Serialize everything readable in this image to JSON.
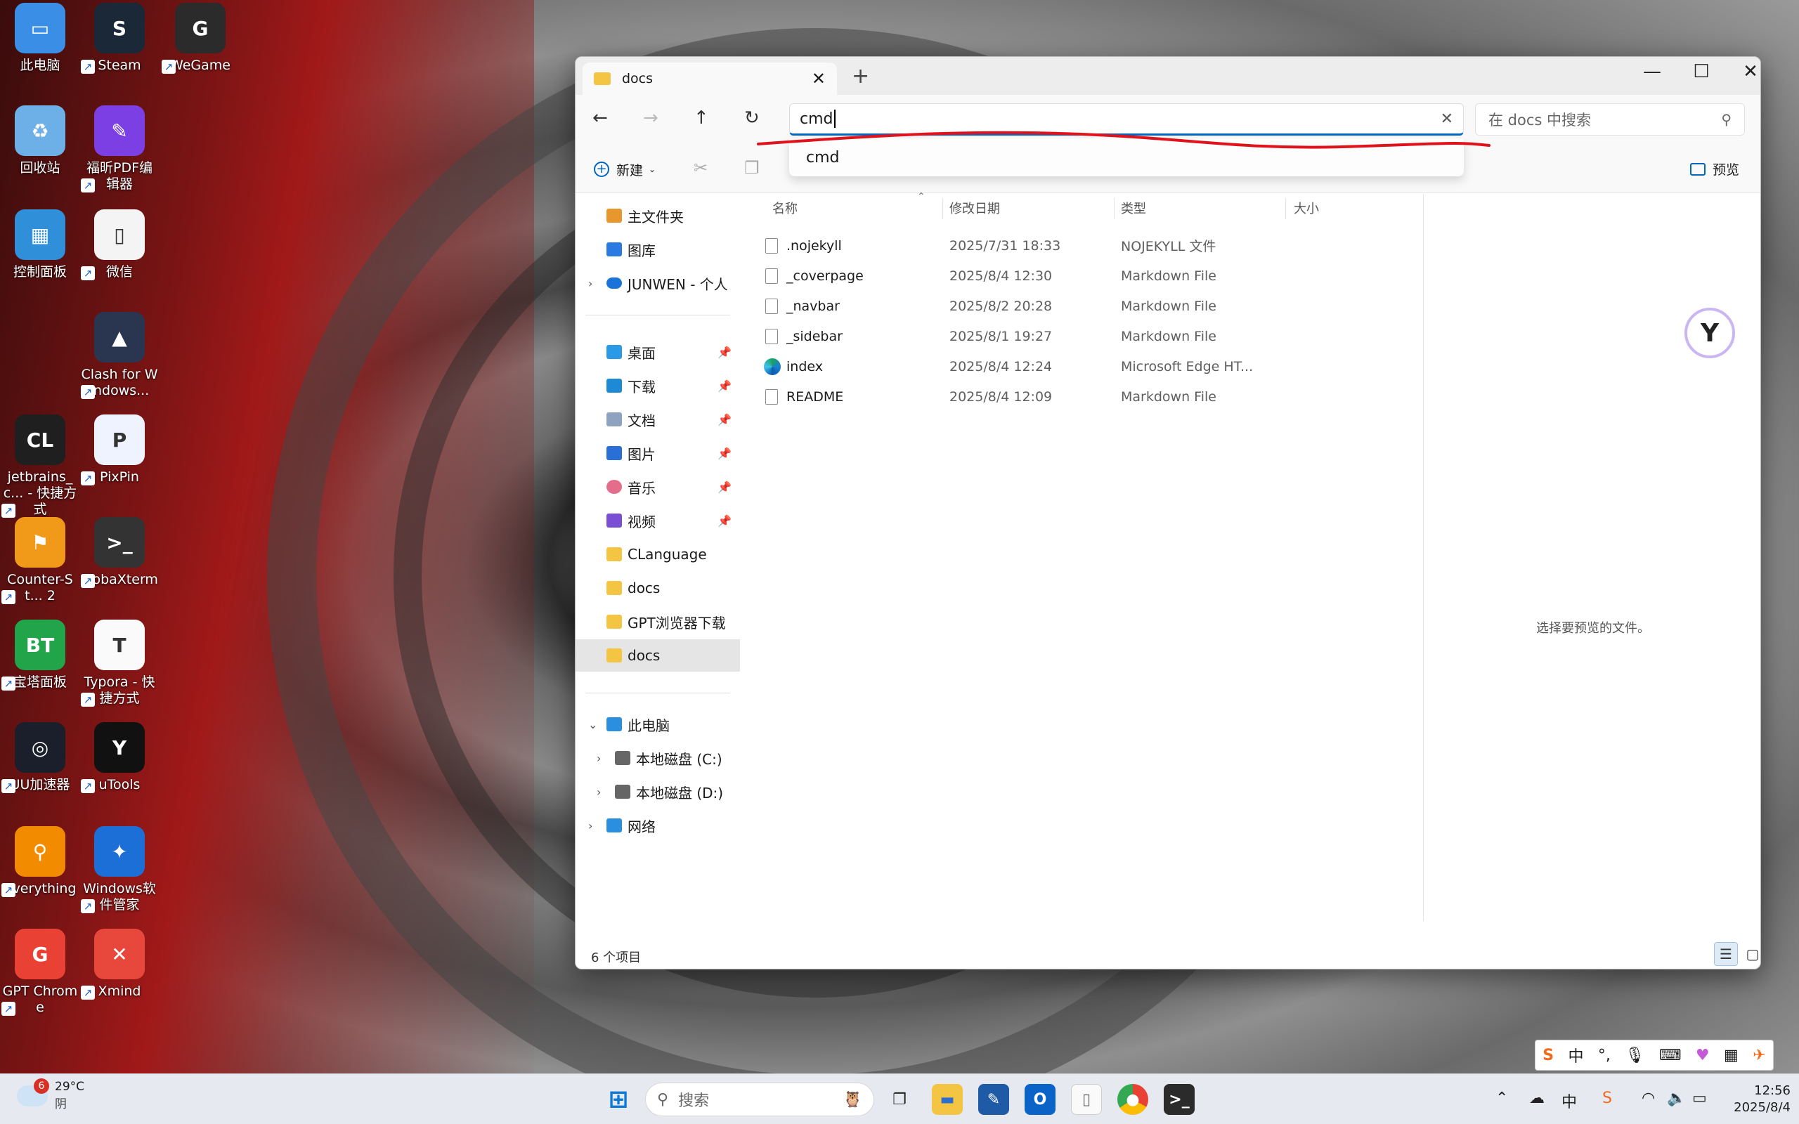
{
  "desktop": {
    "icons": [
      {
        "label": "此电脑",
        "glyph": "▭",
        "color": "#3a8ee6"
      },
      {
        "label": "Steam",
        "glyph": "S",
        "color": "#1b2838"
      },
      {
        "label": "WeGame",
        "glyph": "G",
        "color": "#2b2b2b"
      },
      {
        "label": "回收站",
        "glyph": "♻",
        "color": "#6db0e8"
      },
      {
        "label": "福昕PDF编辑器",
        "glyph": "✎",
        "color": "#7b3fe4"
      },
      {
        "label": "控制面板",
        "glyph": "▦",
        "color": "#2f8fd8"
      },
      {
        "label": "微信",
        "glyph": "▯",
        "color": "#f4f4f4"
      },
      {
        "label": "Clash for Windows...",
        "glyph": "▲",
        "color": "#2a3550"
      },
      {
        "label": "jetbrains_c... - 快捷方式",
        "glyph": "CL",
        "color": "#1f1f1f"
      },
      {
        "label": "PixPin",
        "glyph": "P",
        "color": "#eef3ff"
      },
      {
        "label": "Counter-St... 2",
        "glyph": "⚑",
        "color": "#f19a1a"
      },
      {
        "label": "MobaXterm",
        "glyph": ">_",
        "color": "#333"
      },
      {
        "label": "宝塔面板",
        "glyph": "BT",
        "color": "#21a44a"
      },
      {
        "label": "Typora - 快捷方式",
        "glyph": "T",
        "color": "#fafafa"
      },
      {
        "label": "UU加速器",
        "glyph": "◎",
        "color": "#1b1f2b"
      },
      {
        "label": "uTools",
        "glyph": "Y",
        "color": "#111"
      },
      {
        "label": "Everything",
        "glyph": "⚲",
        "color": "#f28b00"
      },
      {
        "label": "Windows软件管家",
        "glyph": "✦",
        "color": "#1d6fd8"
      },
      {
        "label": "GPT Chrome",
        "glyph": "G",
        "color": "#e94235"
      },
      {
        "label": "Xmind",
        "glyph": "✕",
        "color": "#e8473c"
      }
    ]
  },
  "explorer": {
    "tab_title": "docs",
    "address_value": "cmd",
    "search_placeholder": "在 docs 中搜索",
    "suggestion": "cmd",
    "toolbar": {
      "new_label": "新建",
      "preview_label": "预览"
    },
    "sidebar": {
      "items": [
        {
          "label": "主文件夹",
          "icon": "home-icon",
          "pinned": false
        },
        {
          "label": "图库",
          "icon": "gallery-icon",
          "pinned": false
        },
        {
          "label": "JUNWEN - 个人",
          "icon": "onedrive-icon",
          "pinned": false
        },
        {
          "label": "桌面",
          "icon": "desktop-icon",
          "pinned": true
        },
        {
          "label": "下载",
          "icon": "download-icon",
          "pinned": true
        },
        {
          "label": "文档",
          "icon": "documents-icon",
          "pinned": true
        },
        {
          "label": "图片",
          "icon": "pictures-icon",
          "pinned": true
        },
        {
          "label": "音乐",
          "icon": "music-icon",
          "pinned": true
        },
        {
          "label": "视频",
          "icon": "videos-icon",
          "pinned": true
        },
        {
          "label": "CLanguage",
          "icon": "folder-icon",
          "pinned": false
        },
        {
          "label": "docs",
          "icon": "folder-icon",
          "pinned": false
        },
        {
          "label": "GPT浏览器下载",
          "icon": "folder-icon",
          "pinned": false
        },
        {
          "label": "docs",
          "icon": "folder-icon",
          "pinned": false
        },
        {
          "label": "此电脑",
          "icon": "this-pc-icon",
          "pinned": false
        },
        {
          "label": "本地磁盘 (C:)",
          "icon": "drive-icon",
          "pinned": false
        },
        {
          "label": "本地磁盘 (D:)",
          "icon": "drive-icon",
          "pinned": false
        },
        {
          "label": "网络",
          "icon": "network-icon",
          "pinned": false
        }
      ]
    },
    "columns": {
      "name": "名称",
      "modified": "修改日期",
      "type": "类型",
      "size": "大小"
    },
    "files": [
      {
        "name": ".nojekyll",
        "modified": "2025/7/31 18:33",
        "type": "NOJEKYLL 文件",
        "icon": "file-icon"
      },
      {
        "name": "_coverpage",
        "modified": "2025/8/4 12:30",
        "type": "Markdown File",
        "icon": "file-icon"
      },
      {
        "name": "_navbar",
        "modified": "2025/8/2 20:28",
        "type": "Markdown File",
        "icon": "file-icon"
      },
      {
        "name": "_sidebar",
        "modified": "2025/8/1 19:27",
        "type": "Markdown File",
        "icon": "file-icon"
      },
      {
        "name": "index",
        "modified": "2025/8/4 12:24",
        "type": "Microsoft Edge HT...",
        "icon": "edge-icon"
      },
      {
        "name": "README",
        "modified": "2025/8/4 12:09",
        "type": "Markdown File",
        "icon": "file-icon"
      }
    ],
    "preview_empty_text": "选择要预览的文件。",
    "status_count": "6 个项目"
  },
  "taskbar": {
    "weather_temp": "29°C",
    "weather_desc": "阴",
    "weather_badge": "6",
    "search_placeholder": "搜索",
    "time": "12:56",
    "date": "2025/8/4"
  },
  "ime": {
    "mode": "中"
  },
  "colors": {
    "accent": "#0067c0",
    "annotation_red": "#e0121b"
  }
}
